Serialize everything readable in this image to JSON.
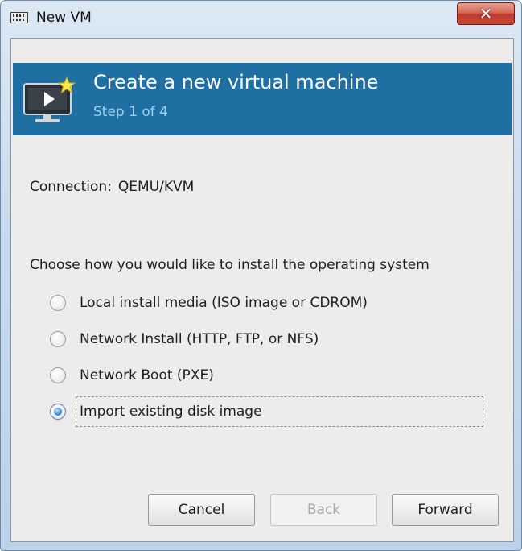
{
  "window": {
    "title": "New VM",
    "close_glyph": "✕"
  },
  "banner": {
    "title": "Create a new virtual machine",
    "step": "Step 1 of 4",
    "color": "#1f6fa3"
  },
  "connection": {
    "label": "Connection:",
    "value": "QEMU/KVM"
  },
  "install": {
    "prompt": "Choose how you would like to install the operating system",
    "options": [
      {
        "label": "Local install media (ISO image or CDROM)",
        "checked": false
      },
      {
        "label": "Network Install (HTTP, FTP, or NFS)",
        "checked": false
      },
      {
        "label": "Network Boot (PXE)",
        "checked": false
      },
      {
        "label": "Import existing disk image",
        "checked": true
      }
    ]
  },
  "buttons": {
    "cancel": "Cancel",
    "back": "Back",
    "forward": "Forward"
  }
}
